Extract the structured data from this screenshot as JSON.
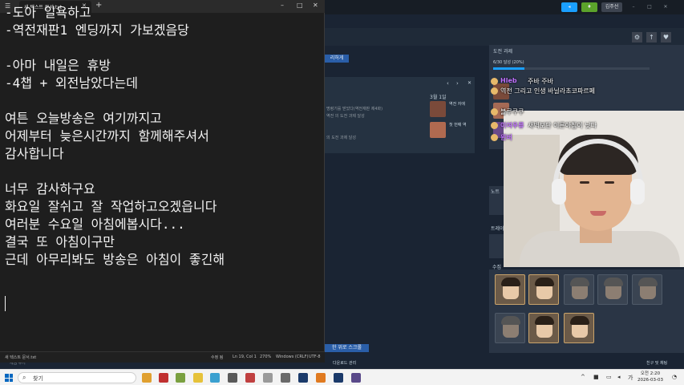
{
  "notepad": {
    "tab_title": "새 텍스트 문서.txt",
    "lines": [
      "-도아 일욕하고",
      "-역전재판1 엔딩까지 가보겠음당",
      "",
      "-아마 내일은 휴방",
      "-4챕 + 외전남았다는데",
      "",
      "여튼 오늘방송은 여기까지고",
      "어제부터 늦은시간까지 함께해주셔서",
      "감사합니다",
      "",
      "너무 감사하구요",
      "화요일 잘쉬고 잘 작업하고오겠읍니다",
      "여러분 수요일 아침에봅시다...",
      "결국 또 아침이구만",
      "근데 아무리봐도 방송은 아침이 좋긴해"
    ],
    "status": {
      "filename": "새 텍스트 문서.txt",
      "position": "Ln 19, Col 1",
      "zoom": "270%",
      "line_ending": "Windows (CRLF)",
      "encoding": "UTF-8",
      "extra": "수정 됨"
    }
  },
  "steam": {
    "user": "김주선",
    "challenge_title": "도전 과제",
    "achievements_progress": "6/30 달성 (20%)",
    "progress_fraction": 0.2,
    "notice_label": "노트",
    "trade_label": "트레이",
    "collect_label": "수집",
    "left_button": "리허게",
    "center_line1": "명령기를 받았다(역전재판 제4화)",
    "center_line2": "역전 의 도전 과제 달성",
    "center_line3": "의 도전 과제 달성",
    "date_label": "3월 1일",
    "item1": "역전 자애",
    "item2": "첫 번째 역",
    "bottom_button": "한 위로 스크롤",
    "download_label": "다운로드 관리",
    "friends_label": "친구 및 채팅",
    "gamelib_label": "게임 추가"
  },
  "chat": [
    {
      "name": "Hleb",
      "message": "주바 주바"
    },
    {
      "name": "",
      "message": "역전 그리고 인생  바닐라초코파르페"
    },
    {
      "name": "",
      "message": "블루쿠쿠"
    },
    {
      "name": "이여우류",
      "message": "새벽보단 이른아침이 낫다"
    },
    {
      "name": "윈버",
      "message": ""
    }
  ],
  "taskbar": {
    "search_label": "찾기",
    "clock_time": "오전 2:20",
    "clock_date": "2026-03-03",
    "ime": "가"
  },
  "colors": {
    "notepad_bg": "#1e1e1e",
    "steam_bg": "#1a2433",
    "steam_blue": "#1a9fff",
    "chat_name": "#c070ff"
  }
}
